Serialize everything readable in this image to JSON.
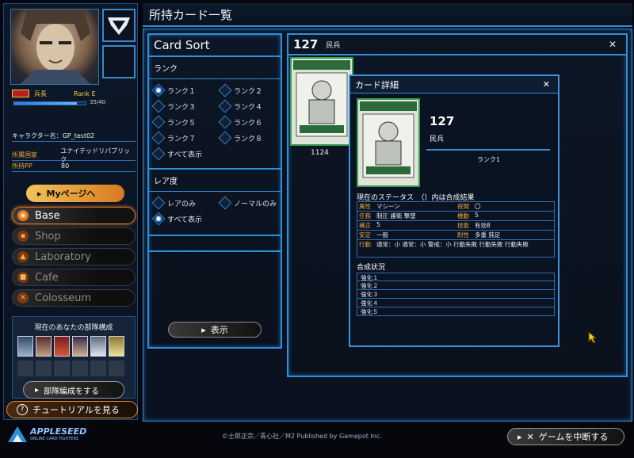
{
  "header": {
    "title": "所持カード一覧"
  },
  "sidebar": {
    "rank_title": "兵長",
    "rank_level": "Rank E",
    "hp_text": "35/40",
    "hp_fraction": 0.875,
    "info": [
      {
        "key": "キャラクター名：",
        "value": "GP_test02"
      },
      {
        "key": "所属国家",
        "value": "ユナイテッドリパブリック"
      },
      {
        "key": "所持PP",
        "value": "80"
      }
    ],
    "mypage_label": "Myページへ",
    "nav": [
      {
        "label": "Base",
        "active": true
      },
      {
        "label": "Shop",
        "active": false
      },
      {
        "label": "Laboratory",
        "active": false
      },
      {
        "label": "Cafe",
        "active": false
      },
      {
        "label": "Colosseum",
        "active": false
      }
    ],
    "squad_title": "現在のあなたの部隊構成",
    "squad_button": "部隊編成をする",
    "tutorial_button": "チュートリアルを見る"
  },
  "sort_panel": {
    "title": "Card Sort",
    "rank_section": "ランク",
    "rank_options": [
      "ランク１",
      "ランク２",
      "ランク３",
      "ランク４",
      "ランク５",
      "ランク６",
      "ランク７",
      "ランク８"
    ],
    "rank_all": "すべて表示",
    "rarity_section": "レア度",
    "rarity_options": [
      "レアのみ",
      "ノーマルのみ"
    ],
    "rarity_all": "すべて表示",
    "show_button": "表示"
  },
  "card_list": {
    "header_num": "127",
    "header_name": "民兵",
    "close": "✕",
    "cards": [
      {
        "count": "1124"
      }
    ]
  },
  "detail": {
    "title": "カード詳細",
    "close": "✕",
    "number": "127",
    "name": "民兵",
    "rank": "ランク1",
    "status_title": "現在のステータス　（）内は合成結果",
    "stats": [
      {
        "k1": "属性",
        "v1": "マシーン",
        "k2": "夜間",
        "v2": "〇"
      },
      {
        "k1": "任務",
        "v1": "制圧 護衛 撃墜",
        "k2": "機動",
        "v2": "5"
      },
      {
        "k1": "補正",
        "v1": "5",
        "k2": "技能",
        "v2": "有効8"
      },
      {
        "k1": "安定",
        "v1": "一般",
        "k2": "耐性",
        "v2": "多重 鈍足"
      }
    ],
    "action_key": "行動",
    "action_val": "通常：小 通常：小 警戒：小 行動失敗 行動失敗 行動失敗",
    "synth_title": "合成状況",
    "synth": [
      "強化１",
      "強化２",
      "強化３",
      "強化４",
      "強化５"
    ]
  },
  "footer": {
    "copyright": "©士郎正宗／青心社／M2 Published by Gamepot Inc.",
    "logo_text": "APPLESEED",
    "logo_sub": "ONLINE CARD FIGHTERS",
    "quit_button": "ゲームを中断する"
  },
  "colors": {
    "accent_blue": "#2f8fd8",
    "accent_orange": "#d8701e",
    "rank_gold": "#f6c64f"
  }
}
